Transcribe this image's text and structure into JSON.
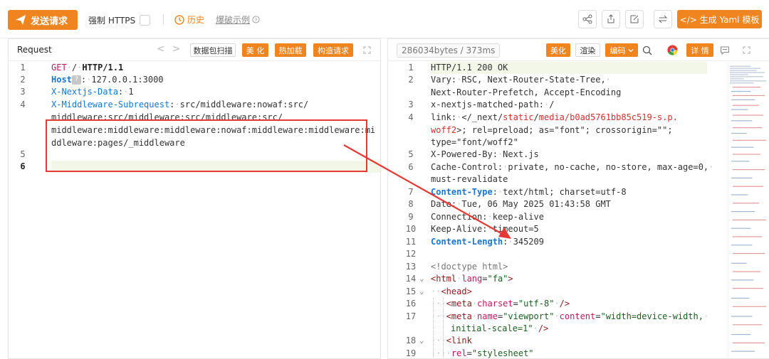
{
  "toolbar": {
    "send_label": "发送请求",
    "force_https_label": "强制 HTTPS",
    "history_label": "历史",
    "blast_label": "爆破示例",
    "yaml_label": "</> 生成 Yaml 模板"
  },
  "request_panel": {
    "title": "Request",
    "buttons": {
      "scan": "数据包扫描",
      "beautify": "美 化",
      "hotload": "热加载",
      "build": "构造请求"
    }
  },
  "response_panel": {
    "size_info": "286034bytes / 373ms",
    "buttons": {
      "beautify": "美化",
      "render": "渲染",
      "encode": "编码",
      "details": "详 情"
    }
  },
  "request_lines": [
    {
      "n": "1",
      "method": "GET",
      "path": "/",
      "proto": "HTTP/1.1"
    },
    {
      "n": "2",
      "key": "Host",
      "value": "127.0.0.1:3000"
    },
    {
      "n": "3",
      "key": "X-Nextjs-Data",
      "value": "1"
    },
    {
      "n": "4",
      "key": "X-Middleware-Subrequest",
      "value": "src/middleware:nowaf:src/",
      "wrap": [
        "middleware:src/middleware:src/middleware:src/",
        "middleware:middleware:middleware:nowaf:middleware:middleware:mi",
        "ddleware:pages/_middleware"
      ]
    },
    {
      "n": "5"
    },
    {
      "n": "6"
    }
  ],
  "response_lines": {
    "l1": {
      "n": "1",
      "text": "HTTP/1.1 200 OK"
    },
    "l2": {
      "n": "2",
      "key": "Vary",
      "value": "RSC, Next-Router-State-Tree,",
      "wrap": "Next-Router-Prefetch, Accept-Encoding"
    },
    "l3": {
      "n": "3",
      "key": "x-nextjs-matched-path",
      "value": "/"
    },
    "l4": {
      "n": "4",
      "key": "link",
      "v1": "</_next/",
      "v2": "static",
      "v3": "/",
      "v4": "media",
      "v5": "/b0ad5761bb85c519-s.p.",
      "wrap1": "woff2",
      "wrap1b": ">; rel=preload; as=\"font\"; crossorigin=\"\";",
      "wrap2": "type=\"font/woff2\""
    },
    "l5": {
      "n": "5",
      "key": "X-Powered-By",
      "value": "Next.js"
    },
    "l6": {
      "n": "6",
      "key": "Cache-Control",
      "value": "private, no-cache, no-store, max-age=0,",
      "wrap": "must-revalidate"
    },
    "l7": {
      "n": "7",
      "key": "Content-Type",
      "value": "text/html; charset=utf-8"
    },
    "l8": {
      "n": "8",
      "key": "Date",
      "value": "Tue, 06 May 2025 01:43:58 GMT"
    },
    "l9": {
      "n": "9",
      "key": "Connection",
      "value": "keep-alive"
    },
    "l10": {
      "n": "10",
      "key": "Keep-Alive",
      "value": "timeout=5"
    },
    "l11": {
      "n": "11",
      "key": "Content-Length",
      "value": "345209"
    },
    "l12": {
      "n": "12"
    },
    "l13": {
      "n": "13",
      "text": "<!doctype html>"
    },
    "l14": {
      "n": "14",
      "tag": "<html",
      "attr": "lang",
      "val": "\"fa\"",
      "close": ">"
    },
    "l15": {
      "n": "15",
      "tag": "<head>"
    },
    "l16": {
      "n": "16",
      "tag": "<meta",
      "attr": "charset",
      "val": "\"utf-8\"",
      "close": "/>"
    },
    "l17": {
      "n": "17",
      "tag": "<meta",
      "attr": "name",
      "val": "\"viewport\"",
      "attr2": "content",
      "val2": "\"width=device-width,",
      "wrap": "initial-scale=1\"",
      "close": "/>"
    },
    "l18": {
      "n": "18",
      "tag": "<link"
    },
    "l19": {
      "n": "19",
      "attr": "rel",
      "val": "\"stylesheet\""
    }
  }
}
